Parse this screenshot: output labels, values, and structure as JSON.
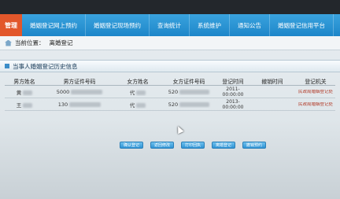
{
  "nav": {
    "brand": "管理",
    "items": [
      "婚姻登记网上预约",
      "婚姻登记现场预约",
      "查询统计",
      "系统维护",
      "通知公告",
      "婚姻登记信用平台"
    ]
  },
  "location": {
    "label": "当前位置：",
    "value": "离婚登记"
  },
  "panel": {
    "title": "当事人婚姻登记历史信息"
  },
  "table": {
    "headers": [
      "男方姓名",
      "男方证件号码",
      "女方姓名",
      "女方证件号码",
      "登记时间",
      "撤销时间",
      "登记机关"
    ],
    "rows": [
      {
        "male_name": "黄",
        "male_id": "5000",
        "female_name": "代",
        "female_id": "520",
        "reg_date": "2011-",
        "reg_time": "00:00:00",
        "cancel": "",
        "org": "民政局婚姻登记处"
      },
      {
        "male_name": "王",
        "male_id": "130",
        "female_name": "代",
        "female_id": "520",
        "reg_date": "2013-",
        "reg_time": "00:00:00",
        "cancel": "",
        "org": "民政局婚姻登记处"
      }
    ]
  },
  "buttons": [
    "确认登记",
    "返回修改",
    "打印回执",
    "离婚登记",
    "撤销预约"
  ],
  "colors": {
    "nav": "#1d86c9",
    "brand": "#e2572b",
    "button": "#2f93d4"
  }
}
